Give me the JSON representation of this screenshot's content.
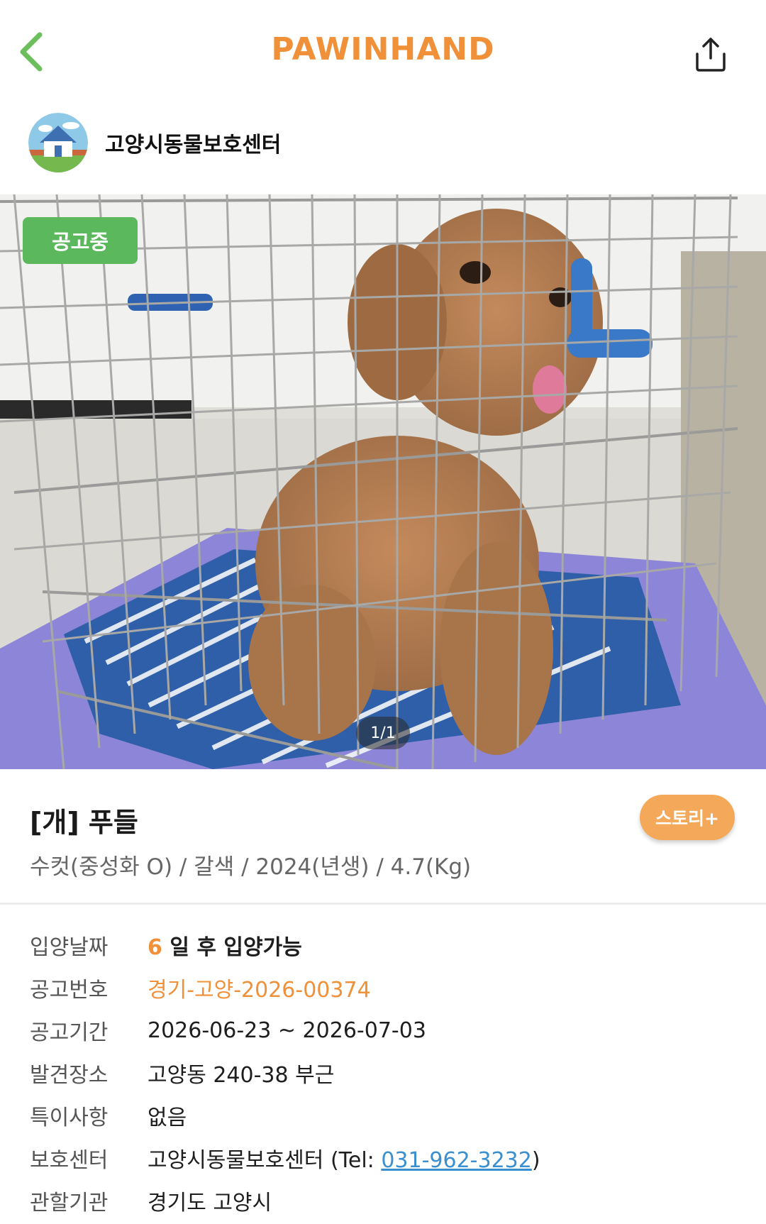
{
  "header": {
    "logo": "PAWINHAND",
    "back_icon": "chevron-left-icon",
    "share_icon": "share-icon"
  },
  "shelter": {
    "name": "고양시동물보호센터",
    "avatar_icon": "house-icon"
  },
  "photo": {
    "status_badge": "공고중",
    "page_counter": "1/1"
  },
  "animal": {
    "title": "[개] 푸들",
    "story_button": "스토리+",
    "summary": "수컷(중성화 O) / 갈색 / 2024(년생) / 4.7(Kg)"
  },
  "info": {
    "adoption_date": {
      "label": "입양날짜",
      "days": "6",
      "text": " 일 후 입양가능"
    },
    "notice_number": {
      "label": "공고번호",
      "value": "경기-고양-2026-00374"
    },
    "notice_period": {
      "label": "공고기간",
      "value": "2026-06-23 ~ 2026-07-03"
    },
    "found_location": {
      "label": "발견장소",
      "value": "고양동 240-38 부근"
    },
    "special_notes": {
      "label": "특이사항",
      "value": "없음"
    },
    "shelter": {
      "label": "보호센터",
      "name": "고양시동물보호센터",
      "tel_prefix": " (Tel: ",
      "tel": "031-962-3232",
      "tel_suffix": ")"
    },
    "agency": {
      "label": "관할기관",
      "value": "경기도 고양시"
    }
  },
  "colors": {
    "brand_orange": "#f0913a",
    "badge_green": "#5cb85c",
    "story_orange": "#f4a85a",
    "link_blue": "#3a8fd0",
    "back_green": "#6cbf5c"
  }
}
